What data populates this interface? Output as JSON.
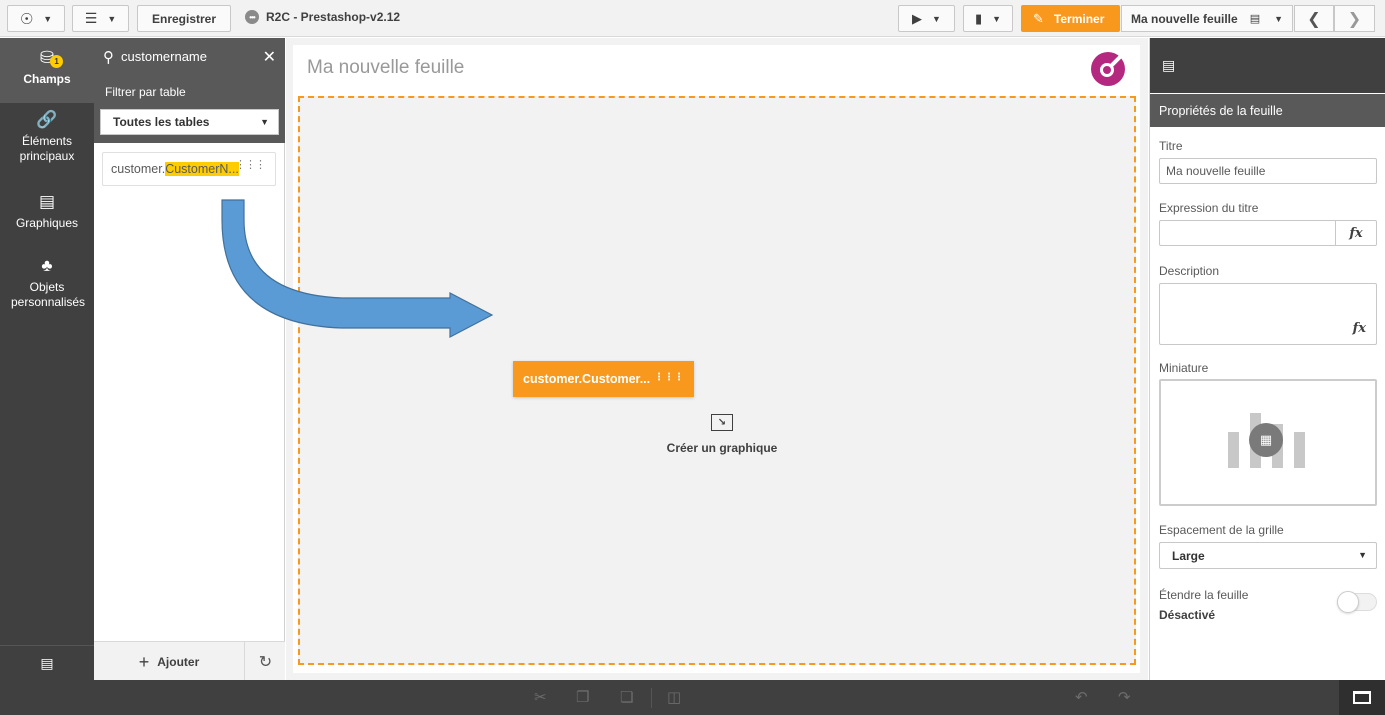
{
  "toolbar": {
    "save_label": "Enregistrer",
    "app_title": "R2C - Prestashop-v2.12",
    "done_label": "Terminer",
    "current_sheet": "Ma nouvelle feuille",
    "icons": [
      "compass-icon",
      "list-icon",
      "presentation-icon",
      "bookmark-icon",
      "pencil-icon",
      "chart-icon",
      "chevron-left-icon",
      "chevron-right-icon"
    ]
  },
  "left_nav": {
    "items": [
      {
        "label": "Champs",
        "icon": "database-icon",
        "badge": "1",
        "active": true
      },
      {
        "label": "Éléments principaux",
        "icon": "link-icon"
      },
      {
        "label": "Graphiques",
        "icon": "bar-chart-icon"
      },
      {
        "label": "Objets personnalisés",
        "icon": "puzzle-icon"
      }
    ]
  },
  "fields_panel": {
    "search_value": "customername",
    "filter_label": "Filtrer par table",
    "table_filter": "Toutes les tables",
    "field_prefix": "customer.",
    "field_match": "CustomerN...",
    "add_label": "Ajouter"
  },
  "canvas": {
    "sheet_title": "Ma nouvelle feuille",
    "dragged_field": "customer.Customer...",
    "create_chart_label": "Créer un graphique"
  },
  "properties": {
    "header": "Propriétés de la feuille",
    "title_label": "Titre",
    "title_value": "Ma nouvelle feuille",
    "title_expr_label": "Expression du titre",
    "title_expr_value": "",
    "description_label": "Description",
    "thumbnail_label": "Miniature",
    "grid_spacing_label": "Espacement de la grille",
    "grid_spacing_value": "Large",
    "extend_label": "Étendre la feuille",
    "extend_value": "Désactivé",
    "fx_label": "fx"
  },
  "colors": {
    "accent": "#f8981d",
    "highlight": "#ffcc00",
    "dark": "#404040",
    "mid": "#595959",
    "arrow": "#5b9bd5",
    "logo": "#b5287f"
  }
}
